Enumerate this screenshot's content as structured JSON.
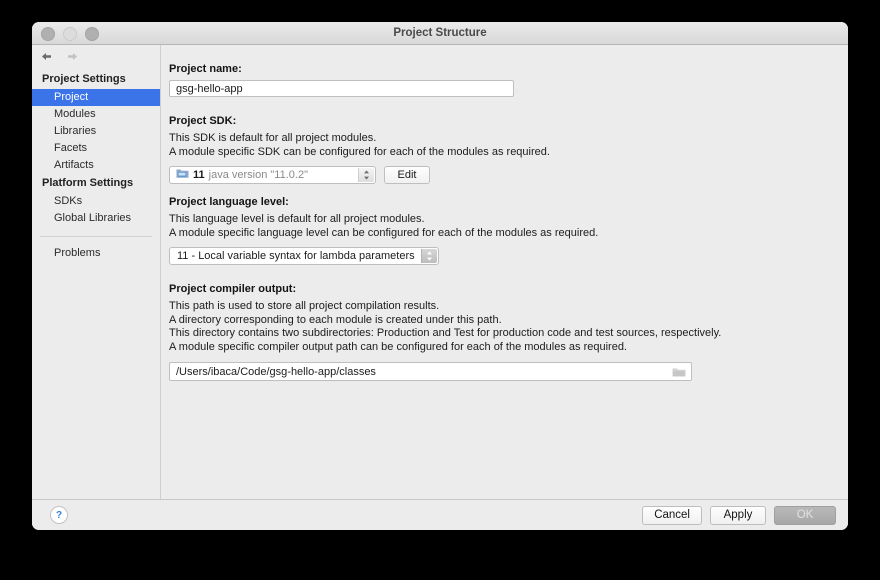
{
  "window": {
    "title": "Project Structure",
    "traffic_lights": [
      "close-button",
      "minimize-button",
      "zoom-button"
    ],
    "nav": {
      "back": "back-arrow",
      "forward": "forward-arrow"
    }
  },
  "sidebar": {
    "groups": [
      {
        "header": "Project Settings",
        "items": [
          {
            "label": "Project",
            "selected": true
          },
          {
            "label": "Modules",
            "selected": false
          },
          {
            "label": "Libraries",
            "selected": false
          },
          {
            "label": "Facets",
            "selected": false
          },
          {
            "label": "Artifacts",
            "selected": false
          }
        ]
      },
      {
        "header": "Platform Settings",
        "items": [
          {
            "label": "SDKs",
            "selected": false
          },
          {
            "label": "Global Libraries",
            "selected": false
          }
        ]
      }
    ],
    "problems": "Problems",
    "selection_color": "#3b73e8"
  },
  "main": {
    "project_name": {
      "label": "Project name:",
      "value": "gsg-hello-app",
      "placeholder": ""
    },
    "project_sdk": {
      "label": "Project SDK:",
      "description": [
        "This SDK is default for all project modules.",
        "A module specific SDK can be configured for each of the modules as required."
      ],
      "selected_name": "11",
      "selected_detail": "java version \"11.0.2\"",
      "icon": "sdk-folder-icon",
      "edit_button": "Edit"
    },
    "language_level": {
      "label": "Project language level:",
      "description": [
        "This language level is default for all project modules.",
        "A module specific language level can be configured for each of the modules as required."
      ],
      "selected": "11 - Local variable syntax for lambda parameters"
    },
    "compiler_output": {
      "label": "Project compiler output:",
      "description": [
        "This path is used to store all project compilation results.",
        "A directory corresponding to each module is created under this path.",
        "This directory contains two subdirectories: Production and Test for production code and test sources, respectively.",
        "A module specific compiler output path can be configured for each of the modules as required."
      ],
      "value": "/Users/ibaca/Code/gsg-hello-app/classes",
      "browse_icon": "folder-browse-icon"
    }
  },
  "footer": {
    "help": "?",
    "cancel": "Cancel",
    "apply": "Apply",
    "ok": "OK",
    "ok_disabled": true
  }
}
